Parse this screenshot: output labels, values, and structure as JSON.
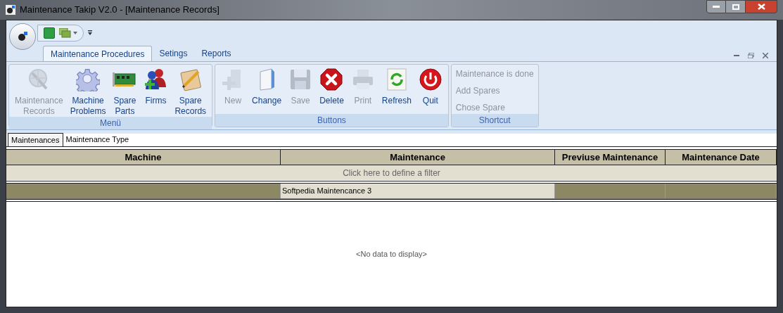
{
  "window": {
    "title": "Maintenance Takip V2.0 - [Maintenance Records]"
  },
  "ribbon_tabs": [
    {
      "label": "Maintenance Procedures",
      "selected": true
    },
    {
      "label": "Setings",
      "selected": false
    },
    {
      "label": "Reports",
      "selected": false
    }
  ],
  "ribbon_groups": [
    {
      "title": "Menü",
      "kind": "large",
      "buttons": [
        {
          "label": "Maintenance Records",
          "disabled": true
        },
        {
          "label": "Machine Problems",
          "disabled": false
        },
        {
          "label": "Spare Parts",
          "disabled": false
        },
        {
          "label": "Firms",
          "disabled": false
        },
        {
          "label": "Spare Records",
          "disabled": false
        }
      ]
    },
    {
      "title": "Buttons",
      "kind": "large",
      "buttons": [
        {
          "label": "New",
          "disabled": true
        },
        {
          "label": "Change",
          "disabled": false
        },
        {
          "label": "Save",
          "disabled": true
        },
        {
          "label": "Delete",
          "disabled": false
        },
        {
          "label": "Print",
          "disabled": true
        },
        {
          "label": "Refresh",
          "disabled": false
        },
        {
          "label": "Quit",
          "disabled": false
        }
      ]
    },
    {
      "title": "Shortcut",
      "kind": "small",
      "buttons": [
        {
          "label": "Maintenance is done",
          "disabled": true
        },
        {
          "label": "Add Spares",
          "disabled": true
        },
        {
          "label": "Chose Spare",
          "disabled": true
        }
      ]
    }
  ],
  "document_tabs": [
    {
      "label": "Maintenances",
      "selected": true
    },
    {
      "label": "Maintenance Type",
      "selected": false
    }
  ],
  "table": {
    "columns": [
      "Machine",
      "Maintenance",
      "Previuse Maintenance",
      "Maintenance Date"
    ],
    "filter_row": "Click here to define a filter",
    "rows": [
      {
        "cells": [
          {
            "text": "",
            "focused": false
          },
          {
            "text": "Softpedia Maintencance 3",
            "focused": true
          },
          {
            "text": "",
            "focused": false
          },
          {
            "text": "",
            "focused": false
          }
        ]
      }
    ],
    "empty_text": "<No data to display>"
  }
}
